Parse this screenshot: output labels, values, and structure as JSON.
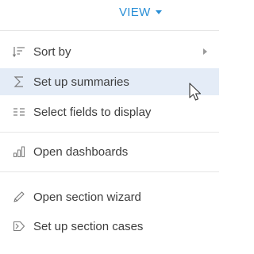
{
  "header": {
    "view_label": "VIEW"
  },
  "menu": {
    "items": [
      {
        "label": "Sort by",
        "icon": "sort-icon",
        "has_submenu": true
      },
      {
        "label": "Set up summaries",
        "icon": "sigma-icon",
        "active": true
      },
      {
        "label": "Select fields to display",
        "icon": "columns-icon"
      },
      {
        "label": "Open dashboards",
        "icon": "bar-chart-icon"
      },
      {
        "label": "Open section wizard",
        "icon": "pencil-icon"
      },
      {
        "label": "Set up section cases",
        "icon": "case-arrow-icon"
      }
    ]
  },
  "colors": {
    "accent": "#2a8fd6",
    "highlight": "#e4ecf7",
    "text": "#3d3d3d",
    "icon": "#7a7a7a"
  }
}
